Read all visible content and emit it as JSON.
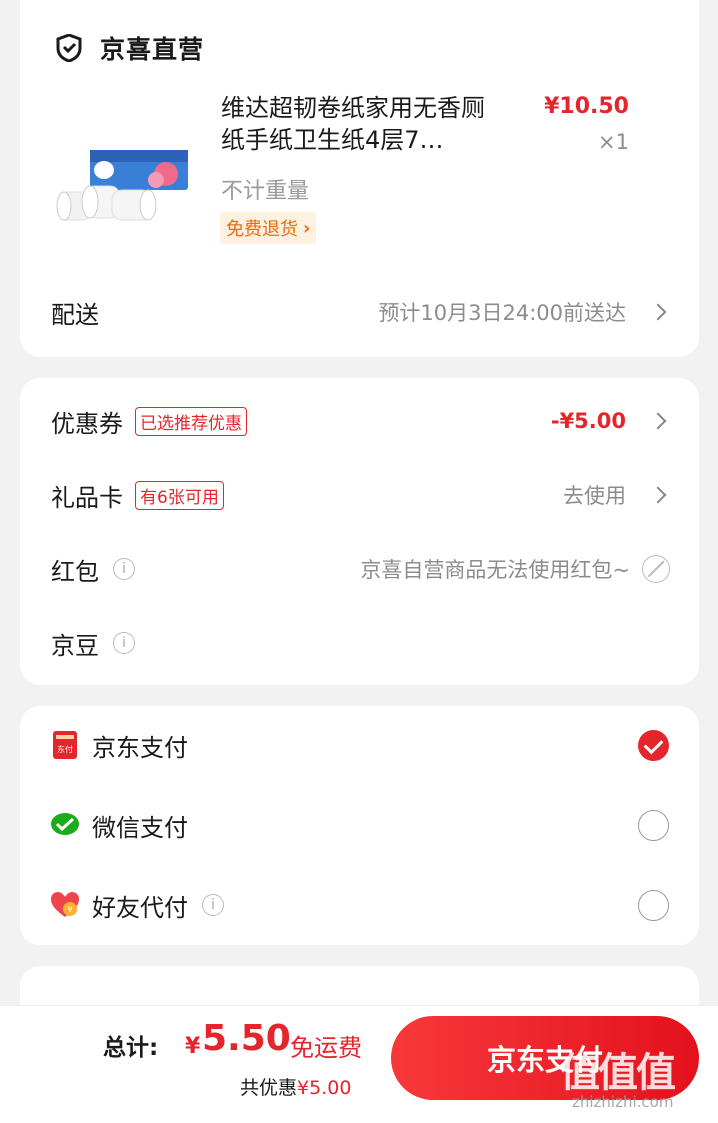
{
  "shop": {
    "name": "京喜直营",
    "product": {
      "title": "维达超韧卷纸家用无香厕纸手纸卫生纸4层7…",
      "price": "¥10.50",
      "qty": "×1",
      "weight": "不计重量",
      "return_tag": "免费退货"
    },
    "delivery": {
      "label": "配送",
      "value": "预计10月3日24:00前送达"
    }
  },
  "discounts": {
    "coupon": {
      "label": "优惠券",
      "tag": "已选推荐优惠",
      "value": "-¥5.00"
    },
    "giftcard": {
      "label": "礼品卡",
      "tag": "有6张可用",
      "value": "去使用"
    },
    "redpacket": {
      "label": "红包",
      "value": "京喜自营商品无法使用红包~"
    },
    "jingdou": {
      "label": "京豆"
    }
  },
  "payment": {
    "options": [
      {
        "label": "京东支付",
        "icon": "jd-pay-icon",
        "checked": true
      },
      {
        "label": "微信支付",
        "icon": "wechat-pay-icon",
        "checked": false
      },
      {
        "label": "好友代付",
        "icon": "friend-pay-icon",
        "checked": false
      }
    ]
  },
  "bottom": {
    "total_label": "总计:",
    "currency": "¥",
    "total_amount": "5.50",
    "free_shipping": "免运费",
    "saved_label": "共优惠",
    "saved_amount": "¥5.00",
    "pay_button": "京东支付"
  },
  "watermark": {
    "main": "值值值",
    "sub": "zhizhizhi.com"
  },
  "colors": {
    "accent": "#e4252c",
    "tag_bg": "#fff1df",
    "tag_text": "#e86d13",
    "wechat": "#1aad19"
  }
}
